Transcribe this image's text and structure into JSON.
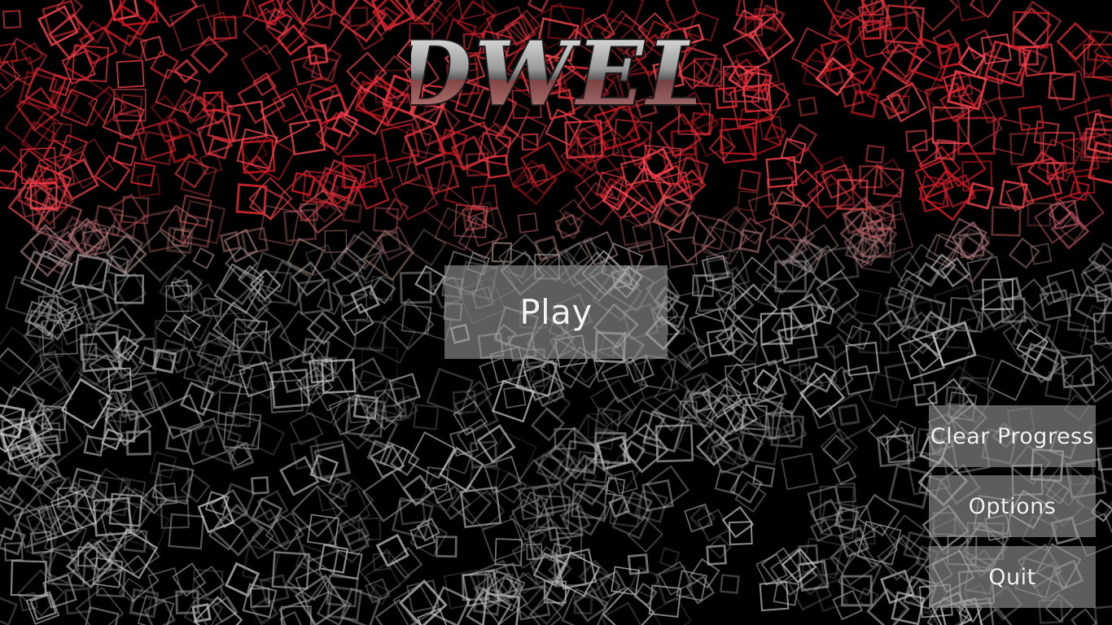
{
  "game": {
    "logo_text": "DWEL",
    "theme": {
      "accent_red": "#e0101e",
      "button_bg": "#969696",
      "button_text": "#f2f2f2",
      "background": "#000000"
    }
  },
  "menu": {
    "play_label": "Play",
    "clear_progress_label": "Clear Progress",
    "options_label": "Options",
    "quit_label": "Quit"
  },
  "background": {
    "pattern": "scattered-outlined-squares",
    "top_tint": "red",
    "bottom_tint": "grey"
  }
}
